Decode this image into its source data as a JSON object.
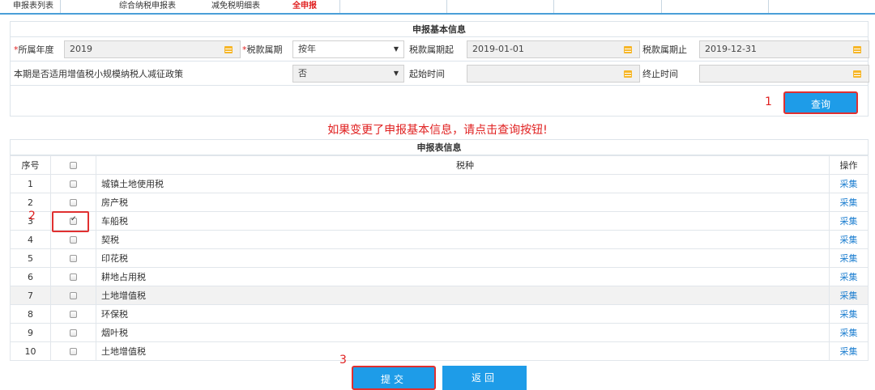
{
  "tabs": [
    "申报表列表",
    "综合纳税申报表",
    "减免税明细表",
    "全申报"
  ],
  "basic_section": {
    "title": "申报基本信息"
  },
  "form": {
    "row1": {
      "year_label": "所属年度",
      "year_value": "2019",
      "period_type_label": "税款属期",
      "period_type_value": "按年",
      "start_label": "税款属期起",
      "start_value": "2019-01-01",
      "end_label": "税款属期止",
      "end_value": "2019-12-31"
    },
    "row2": {
      "policy_label": "本期是否适用增值税小规模纳税人减征政策",
      "policy_value": "否",
      "begin_label": "起始时间",
      "begin_value": "",
      "finish_label": "终止时间",
      "finish_value": ""
    },
    "query_label": "查询"
  },
  "markers": {
    "m1": "1",
    "m2": "2",
    "m3": "3"
  },
  "notice": "如果变更了申报基本信息，请点击查询按钮!",
  "table_section": {
    "title": "申报表信息"
  },
  "table": {
    "headers": {
      "no": "序号",
      "name": "税种",
      "op": "操作"
    },
    "rows": [
      {
        "no": "1",
        "name": "城镇土地使用税",
        "op": "采集",
        "checked": false
      },
      {
        "no": "2",
        "name": "房产税",
        "op": "采集",
        "checked": false
      },
      {
        "no": "3",
        "name": "车船税",
        "op": "采集",
        "checked": true
      },
      {
        "no": "4",
        "name": "契税",
        "op": "采集",
        "checked": false
      },
      {
        "no": "5",
        "name": "印花税",
        "op": "采集",
        "checked": false
      },
      {
        "no": "6",
        "name": "耕地占用税",
        "op": "采集",
        "checked": false
      },
      {
        "no": "7",
        "name": "土地增值税",
        "op": "采集",
        "checked": false
      },
      {
        "no": "8",
        "name": "环保税",
        "op": "采集",
        "checked": false
      },
      {
        "no": "9",
        "name": "烟叶税",
        "op": "采集",
        "checked": false
      },
      {
        "no": "10",
        "name": "土地增值税",
        "op": "采集",
        "checked": false
      }
    ]
  },
  "buttons": {
    "submit": "提交",
    "back": "返回"
  },
  "colors": {
    "accent": "#1e9ce8",
    "highlight": "#e03030",
    "required": "#e02020",
    "calendar": "#f6b628"
  }
}
